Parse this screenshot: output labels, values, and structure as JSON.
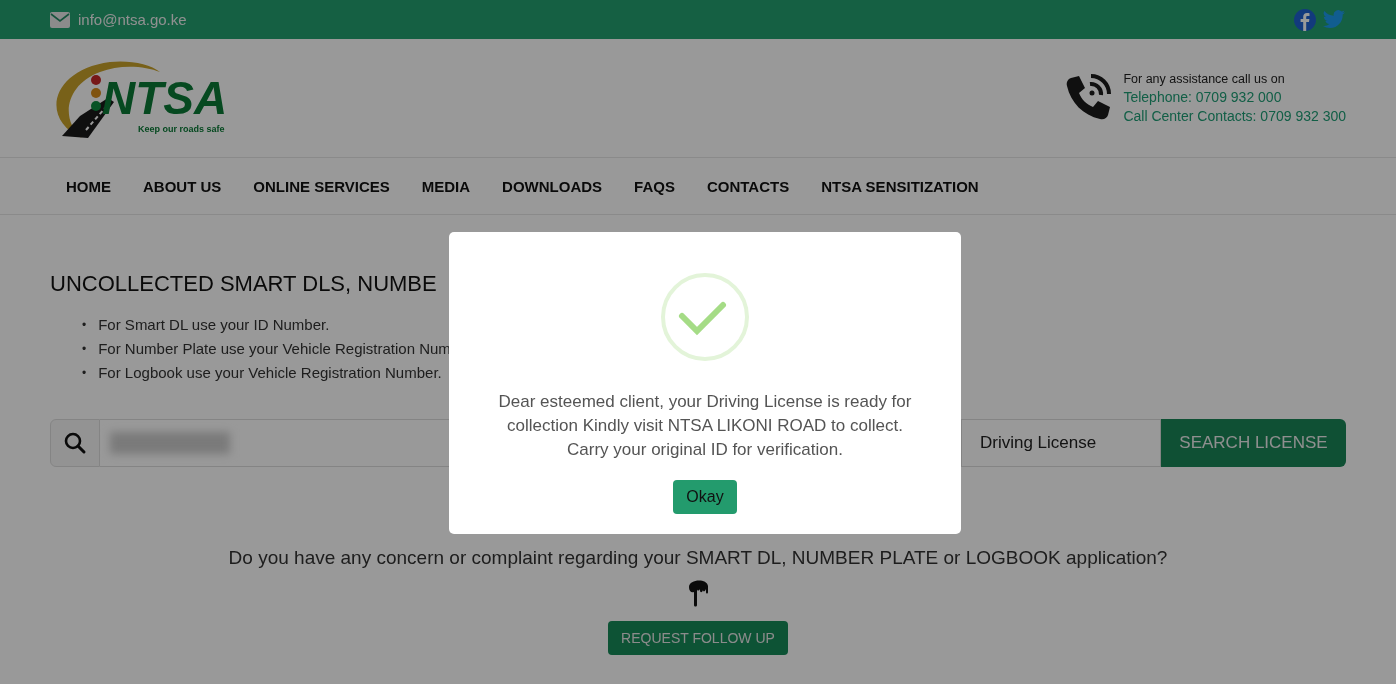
{
  "top_bar": {
    "email": "info@ntsa.go.ke"
  },
  "header": {
    "logo": {
      "name": "NTSA",
      "tagline": "Keep our roads safe"
    },
    "assistance": "For any assistance call us on",
    "telephone": "Telephone: 0709 932 000",
    "call_center": "Call Center Contacts: 0709 932 300"
  },
  "nav": [
    "HOME",
    "ABOUT US",
    "ONLINE SERVICES",
    "MEDIA",
    "DOWNLOADS",
    "FAQS",
    "CONTACTS",
    "NTSA SENSITIZATION"
  ],
  "main": {
    "heading": "UNCOLLECTED SMART DLS, NUMBE",
    "instructions": [
      {
        "marker": "•",
        "text": "For Smart DL use your ID Number."
      },
      {
        "marker": "•",
        "text": "For Number Plate use your Vehicle Registration Num"
      },
      {
        "marker": "•",
        "text": "For Logbook use your Vehicle Registration Number."
      }
    ],
    "search": {
      "document_type": "Driving License",
      "button": "SEARCH LICENSE"
    },
    "concern": "Do you have any concern or complaint regarding your SMART DL, NUMBER PLATE or LOGBOOK application?",
    "follow_up_button": "REQUEST FOLLOW UP"
  },
  "modal": {
    "message": "Dear esteemed client, your Driving License is ready for collection Kindly visit NTSA LIKONI ROAD to collect. Carry your original ID for verification.",
    "button": "Okay"
  }
}
